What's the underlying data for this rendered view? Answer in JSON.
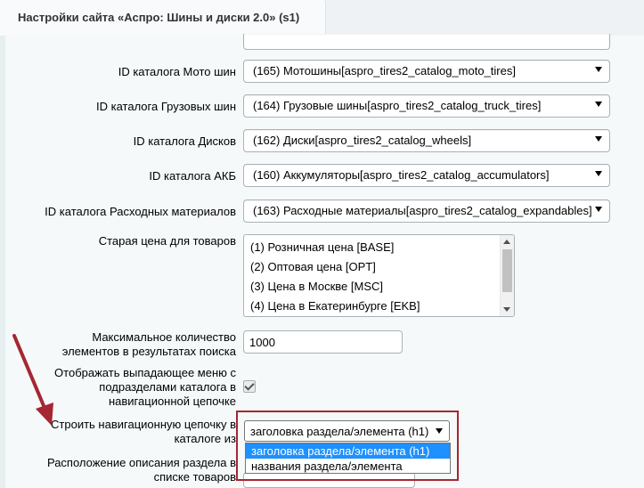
{
  "window": {
    "tab_title": "Настройки сайта «Аспро: Шины и диски 2.0» (s1)"
  },
  "rows": {
    "moto": {
      "label": "ID каталога Мото шин",
      "value": "(165) Мотошины[aspro_tires2_catalog_moto_tires]"
    },
    "truck": {
      "label": "ID каталога Грузовых шин",
      "value": "(164) Грузовые шины[aspro_tires2_catalog_truck_tires]"
    },
    "wheels": {
      "label": "ID каталога Дисков",
      "value": "(162) Диски[aspro_tires2_catalog_wheels]"
    },
    "akb": {
      "label": "ID каталога АКБ",
      "value": "(160) Аккумуляторы[aspro_tires2_catalog_accumulators]"
    },
    "expendables": {
      "label": "ID каталога Расходных материалов",
      "value": "(163) Расходные материалы[aspro_tires2_catalog_expandables]"
    },
    "old_price": {
      "label": "Старая цена для товаров",
      "options": [
        "(1) Розничная цена [BASE]",
        "(2) Оптовая цена [OPT]",
        "(3) Цена в Москве [MSC]",
        "(4) Цена в Екатеринбурге [EKB]"
      ]
    },
    "max_results": {
      "label_line1": "Максимальное количество",
      "label_line2": "элементов в результатах поиска",
      "value": "1000"
    },
    "dropdown_menu": {
      "label_line1": "Отображать выпадающее меню с",
      "label_line2": "подразделами каталога в",
      "label_line3": "навигационной цепочке",
      "checked": true
    },
    "breadcrumb": {
      "label_line1": "Строить навигационную цепочку в",
      "label_line2": "каталоге из",
      "value": "заголовка раздела/элемента (h1)",
      "options": [
        "заголовка раздела/элемента (h1)",
        "названия раздела/элемента"
      ]
    },
    "section_desc": {
      "label_line1": "Расположение описания раздела в",
      "label_line2": "списке товаров"
    }
  },
  "colors": {
    "highlight": "#a62633",
    "selected_option": "#1e90ff",
    "annotation_arrow": "#a62633"
  }
}
